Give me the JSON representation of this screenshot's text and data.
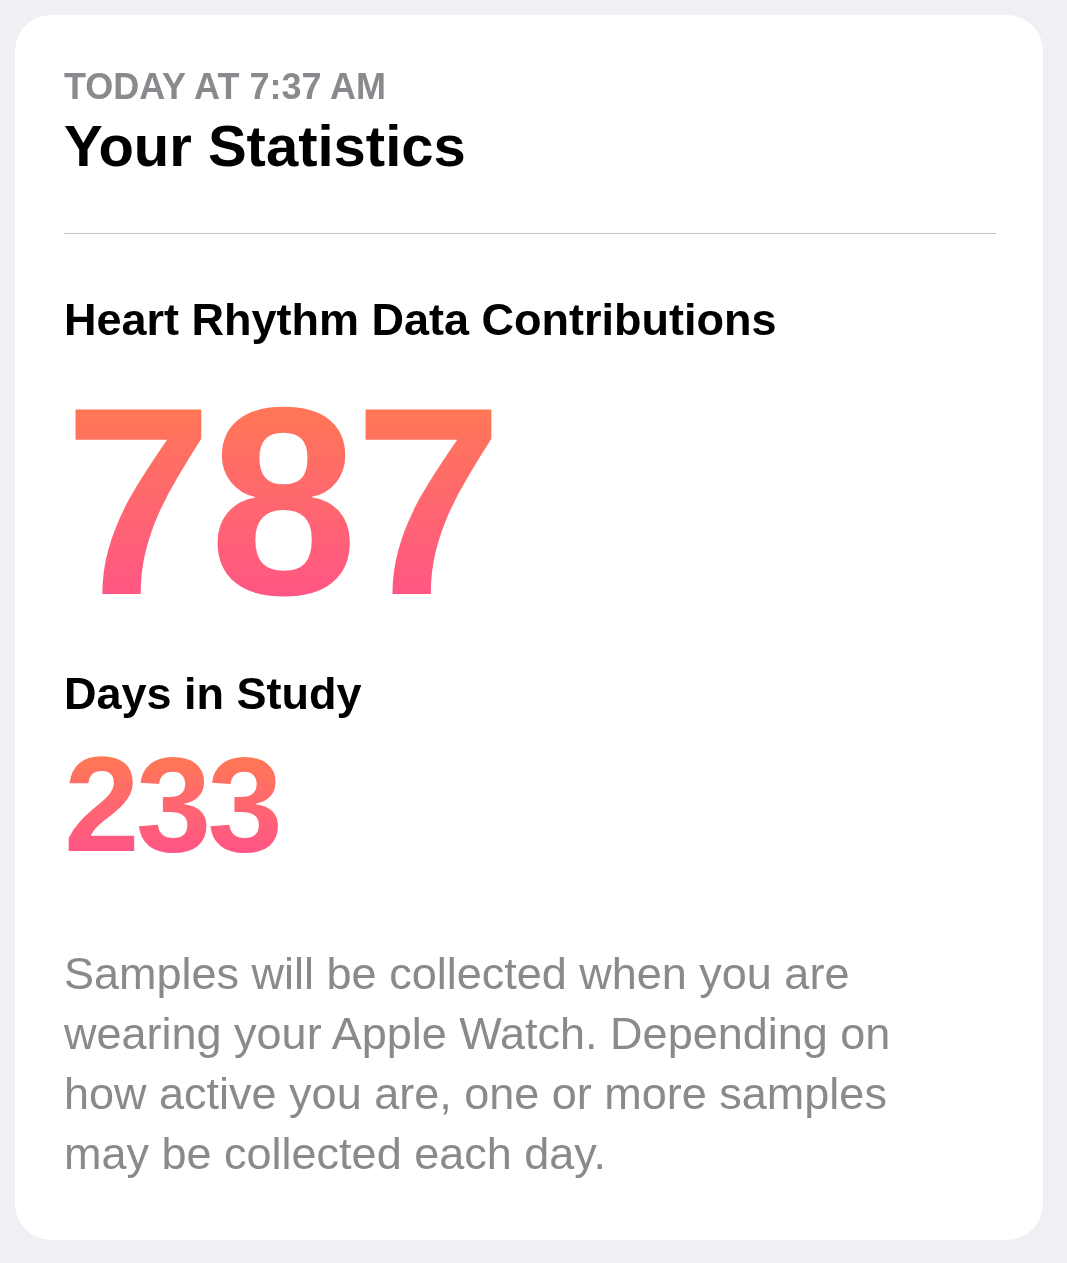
{
  "card": {
    "timestamp": "TODAY AT 7:37 AM",
    "title": "Your Statistics",
    "stats": [
      {
        "label": "Heart Rhythm Data Contributions",
        "value": "787",
        "kind": "large"
      },
      {
        "label": "Days in Study",
        "value": "233",
        "kind": "medium"
      }
    ],
    "note": "Samples will be collected when you are wearing your Apple Watch. Depending on how active you are, one or more samples may be collected each day."
  }
}
